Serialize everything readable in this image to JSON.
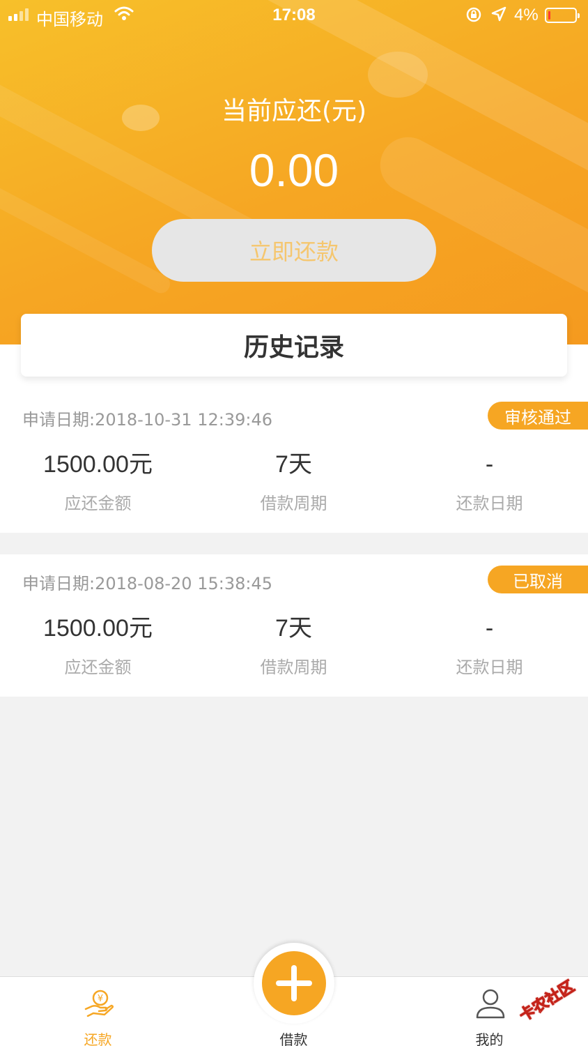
{
  "status_bar": {
    "carrier": "中国移动",
    "time": "17:08",
    "battery_pct": "4%",
    "battery_level": 0.04
  },
  "hero": {
    "title": "当前应还(元)",
    "amount": "0.00",
    "repay_button": "立即还款"
  },
  "history": {
    "title": "历史记录",
    "records": [
      {
        "date": "申请日期:2018-10-31 12:39:46",
        "status": "审核通过",
        "amount": "1500.00元",
        "amount_label": "应还金额",
        "period": "7天",
        "period_label": "借款周期",
        "repay_date": "-",
        "repay_date_label": "还款日期"
      },
      {
        "date": "申请日期:2018-08-20 15:38:45",
        "status": "已取消",
        "amount": "1500.00元",
        "amount_label": "应还金额",
        "period": "7天",
        "period_label": "借款周期",
        "repay_date": "-",
        "repay_date_label": "还款日期"
      }
    ]
  },
  "tabs": [
    {
      "label": "还款",
      "icon": "repay-hand-yen-icon",
      "active": true
    },
    {
      "label": "借款",
      "icon": "plus-icon",
      "active": false
    },
    {
      "label": "我的",
      "icon": "user-icon",
      "active": false
    }
  ],
  "watermark": "卡农社区",
  "colors": {
    "accent": "#f6a623",
    "button_disabled_bg": "#e6e6e6",
    "button_disabled_text": "#f5c66e",
    "battery_low": "#ff3b30"
  }
}
